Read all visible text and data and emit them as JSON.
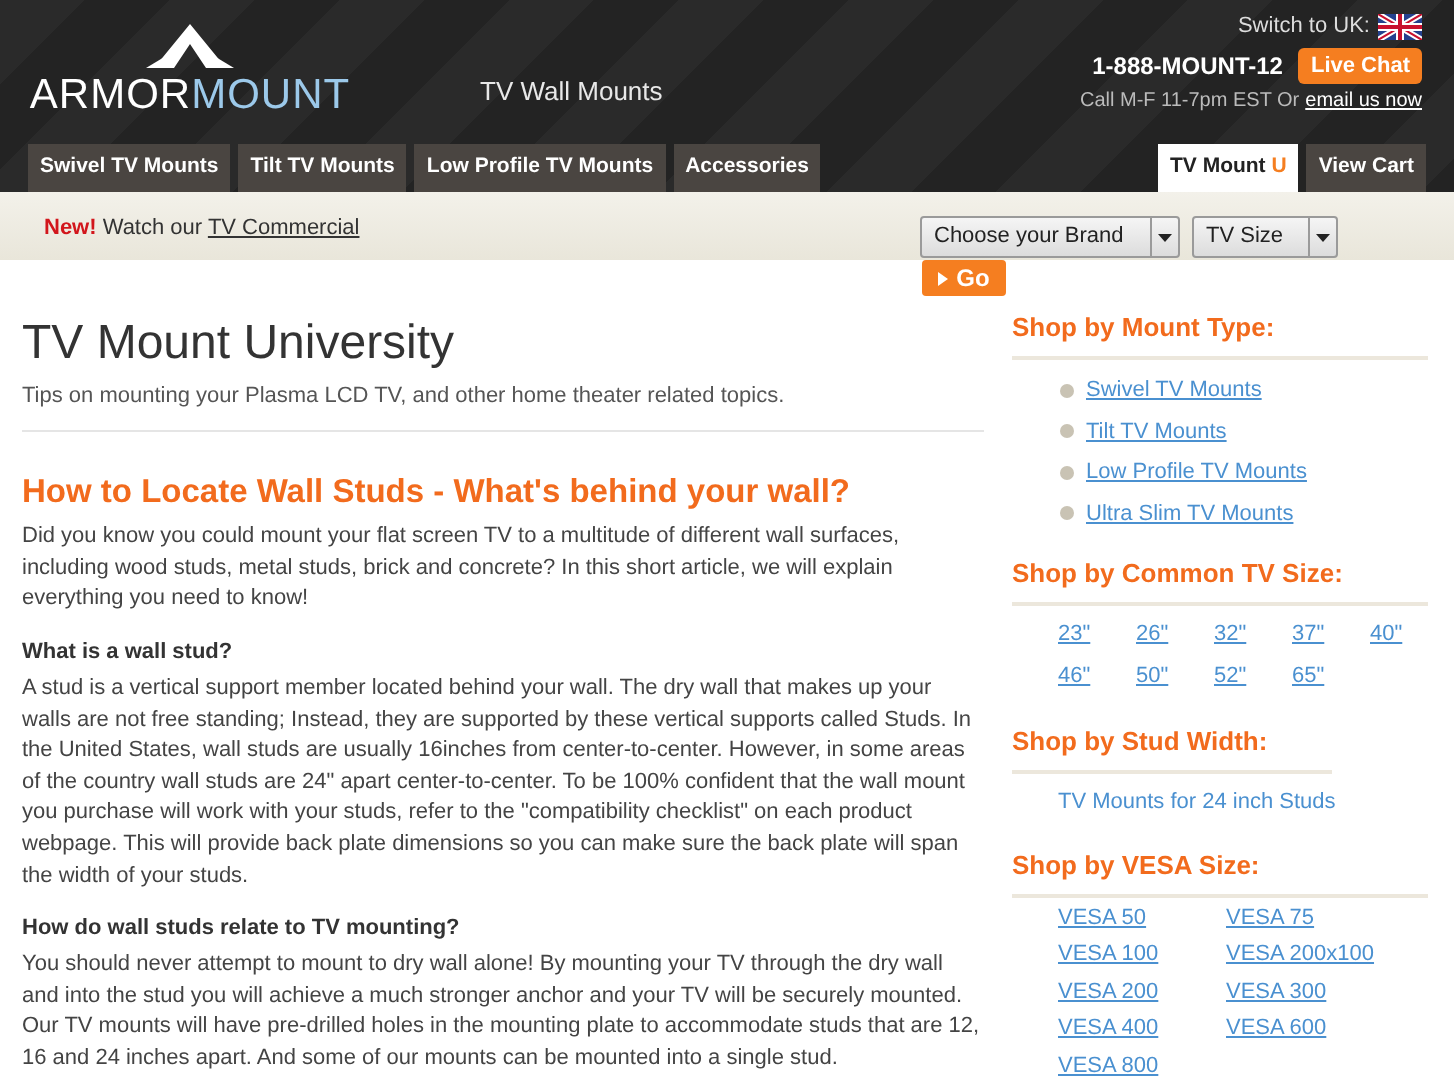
{
  "header": {
    "logo": {
      "part_1": "ARMOR",
      "part_2": "MOUNT"
    },
    "tagline": "TV Wall Mounts",
    "switch_label": "Switch to UK:",
    "phone": "1-888-MOUNT-12",
    "live_chat": "Live Chat",
    "hours": "Call M-F 11-7pm EST Or",
    "email_link": "email us now"
  },
  "nav": {
    "tabs": [
      {
        "label": "Swivel TV Mounts",
        "selected": false
      },
      {
        "label": "Tilt TV Mounts",
        "selected": false
      },
      {
        "label": "Low Profile TV Mounts",
        "selected": false
      },
      {
        "label": "Accessories",
        "selected": false
      }
    ],
    "right_tabs": [
      {
        "label": "TV Mount ",
        "accent": "U",
        "selected": true
      },
      {
        "label": "View Cart",
        "selected": false
      }
    ]
  },
  "promo": {
    "badge": "New!",
    "text": "Watch our",
    "link": "TV Commercial"
  },
  "filters": {
    "brand": "Choose your Brand",
    "size": "TV Size",
    "go": "Go"
  },
  "article": {
    "title": "TV Mount University",
    "subtitle": "Tips on mounting your Plasma LCD TV, and other home theater related topics.",
    "heading": "How to Locate Wall Studs - What's behind your wall?",
    "intro": "Did you know you could mount your flat screen TV to a multitude of different wall surfaces, including wood studs, metal studs, brick and concrete? In this short article, we will explain everything you need to know!",
    "sections": [
      {
        "question": "What is a wall stud?",
        "answer": "A stud is a vertical support member located behind your wall. The dry wall that makes up your walls are not free standing; Instead, they are supported by these vertical supports called Studs. In the United States, wall studs are usually 16inches from center-to-center. However, in some areas of the country wall studs are 24\" apart center-to-center. To be 100% confident that the wall mount you purchase will work with your studs, refer to the \"compatibility checklist\" on each product webpage. This will provide back plate dimensions so you can make sure the back plate will span the width of your studs."
      },
      {
        "question": "How do wall studs relate to TV mounting?",
        "answer": "You should never attempt to mount to dry wall alone! By mounting your TV through the dry wall and into the stud you will achieve a much stronger anchor and your TV will be securely mounted. Our TV mounts will have pre-drilled holes in the mounting plate to accommodate studs that are 12, 16 and 24 inches apart. And some of our mounts can be mounted into a single stud."
      }
    ]
  },
  "sidebar": {
    "mount_type": {
      "title": "Shop by Mount Type:",
      "links": [
        "Swivel TV Mounts",
        "Tilt TV Mounts",
        "Low Profile TV Mounts",
        "Ultra Slim TV Mounts"
      ]
    },
    "tv_size": {
      "title": "Shop by Common TV Size:",
      "links": [
        "23\"",
        "26\"",
        "32\"",
        "37\"",
        "40\"",
        "46\"",
        "50\"",
        "52\"",
        "65\""
      ]
    },
    "stud_width": {
      "title": "Shop by Stud Width:",
      "links": [
        "TV Mounts for 24 inch Studs"
      ]
    },
    "vesa": {
      "title": "Shop by VESA Size:",
      "links": [
        "VESA 50",
        "VESA 75",
        "VESA 100",
        "VESA 200x100",
        "VESA 200",
        "VESA 300",
        "VESA 400",
        "VESA 600",
        "VESA 800"
      ]
    }
  }
}
